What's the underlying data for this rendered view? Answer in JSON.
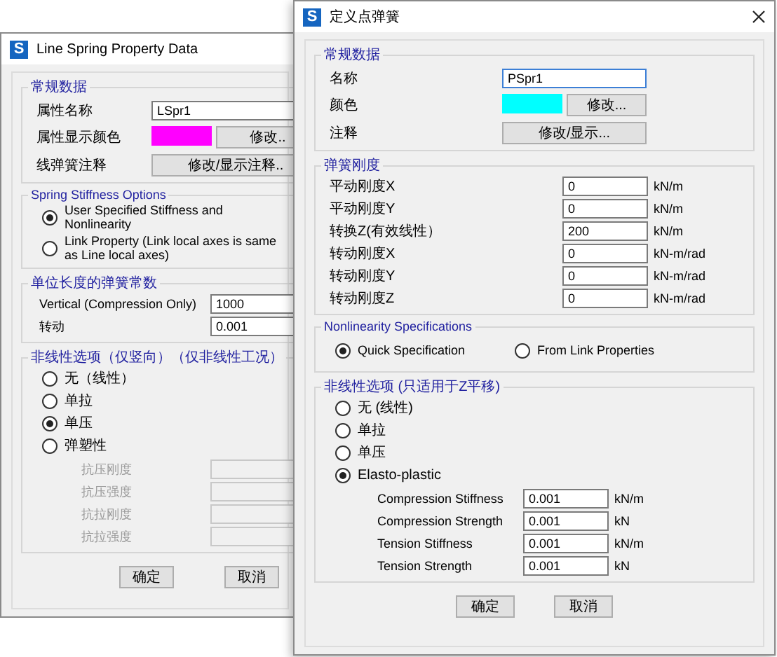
{
  "back_window": {
    "icon_letter": "S",
    "title": "Line Spring Property Data",
    "general": {
      "title": "常规数据",
      "name": {
        "label": "属性名称",
        "value": "LSpr1"
      },
      "color": {
        "label": "属性显示颜色",
        "color": "#ff00ff",
        "button": "修改.."
      },
      "notes": {
        "label": "线弹簧注释",
        "button": "修改/显示注释.."
      }
    },
    "stiffness_options": {
      "title": "Spring Stiffness Options",
      "options": [
        {
          "label": "User Specified Stiffness and Nonlinearity",
          "selected": true
        },
        {
          "label": "Link Property (Link local axes is same as Line local axes)",
          "selected": false
        }
      ]
    },
    "constants": {
      "title": "单位长度的弹簧常数",
      "rows": [
        {
          "label": "Vertical  (Compression Only)",
          "value": "1000"
        },
        {
          "label": "转动",
          "value": "0.001"
        }
      ]
    },
    "nonlinear": {
      "title": "非线性选项（仅竖向）（仅非线性工况）",
      "options": [
        {
          "label": "无（线性）",
          "selected": false
        },
        {
          "label": "单拉",
          "selected": false
        },
        {
          "label": "单压",
          "selected": true
        },
        {
          "label": "弹塑性",
          "selected": false
        }
      ],
      "params": [
        {
          "label": "抗压刚度",
          "disabled": true
        },
        {
          "label": "抗压强度",
          "disabled": true
        },
        {
          "label": "抗拉刚度",
          "disabled": true
        },
        {
          "label": "抗拉强度",
          "disabled": true
        }
      ]
    },
    "buttons": [
      "确定",
      "取消"
    ]
  },
  "front_window": {
    "icon_letter": "S",
    "title": "定义点弹簧",
    "general": {
      "title": "常规数据",
      "name": {
        "label": "名称",
        "value": "PSpr1"
      },
      "color": {
        "label": "颜色",
        "color": "#00ffff",
        "button": "修改..."
      },
      "notes": {
        "label": "注释",
        "button": "修改/显示..."
      }
    },
    "stiffness": {
      "title": "弹簧刚度",
      "rows": [
        {
          "label": "平动刚度X",
          "value": "0",
          "unit": "kN/m"
        },
        {
          "label": "平动刚度Y",
          "value": "0",
          "unit": "kN/m"
        },
        {
          "label": "转换Z(有效线性）",
          "value": "200",
          "unit": "kN/m"
        },
        {
          "label": "转动刚度X",
          "value": "0",
          "unit": "kN-m/rad"
        },
        {
          "label": "转动刚度Y",
          "value": "0",
          "unit": "kN-m/rad"
        },
        {
          "label": "转动刚度Z",
          "value": "0",
          "unit": "kN-m/rad"
        }
      ]
    },
    "nonlinearity_specs": {
      "title": "Nonlinearity Specifications",
      "options": [
        {
          "label": "Quick Specification",
          "selected": true
        },
        {
          "label": "From Link Properties",
          "selected": false
        }
      ]
    },
    "nonlinear": {
      "title": "非线性选项 (只适用于Z平移)",
      "options": [
        {
          "label": "无 (线性)",
          "selected": false
        },
        {
          "label": "单拉",
          "selected": false
        },
        {
          "label": "单压",
          "selected": false
        },
        {
          "label": "Elasto-plastic",
          "selected": true
        }
      ],
      "params": [
        {
          "label": "Compression Stiffness",
          "value": "0.001",
          "unit": "kN/m",
          "disabled": false
        },
        {
          "label": "Compression Strength",
          "value": "0.001",
          "unit": "kN",
          "disabled": false
        },
        {
          "label": "Tension Stiffness",
          "value": "0.001",
          "unit": "kN/m",
          "disabled": false
        },
        {
          "label": "Tension Strength",
          "value": "0.001",
          "unit": "kN",
          "disabled": false
        }
      ]
    },
    "buttons": [
      "确定",
      "取消"
    ]
  }
}
